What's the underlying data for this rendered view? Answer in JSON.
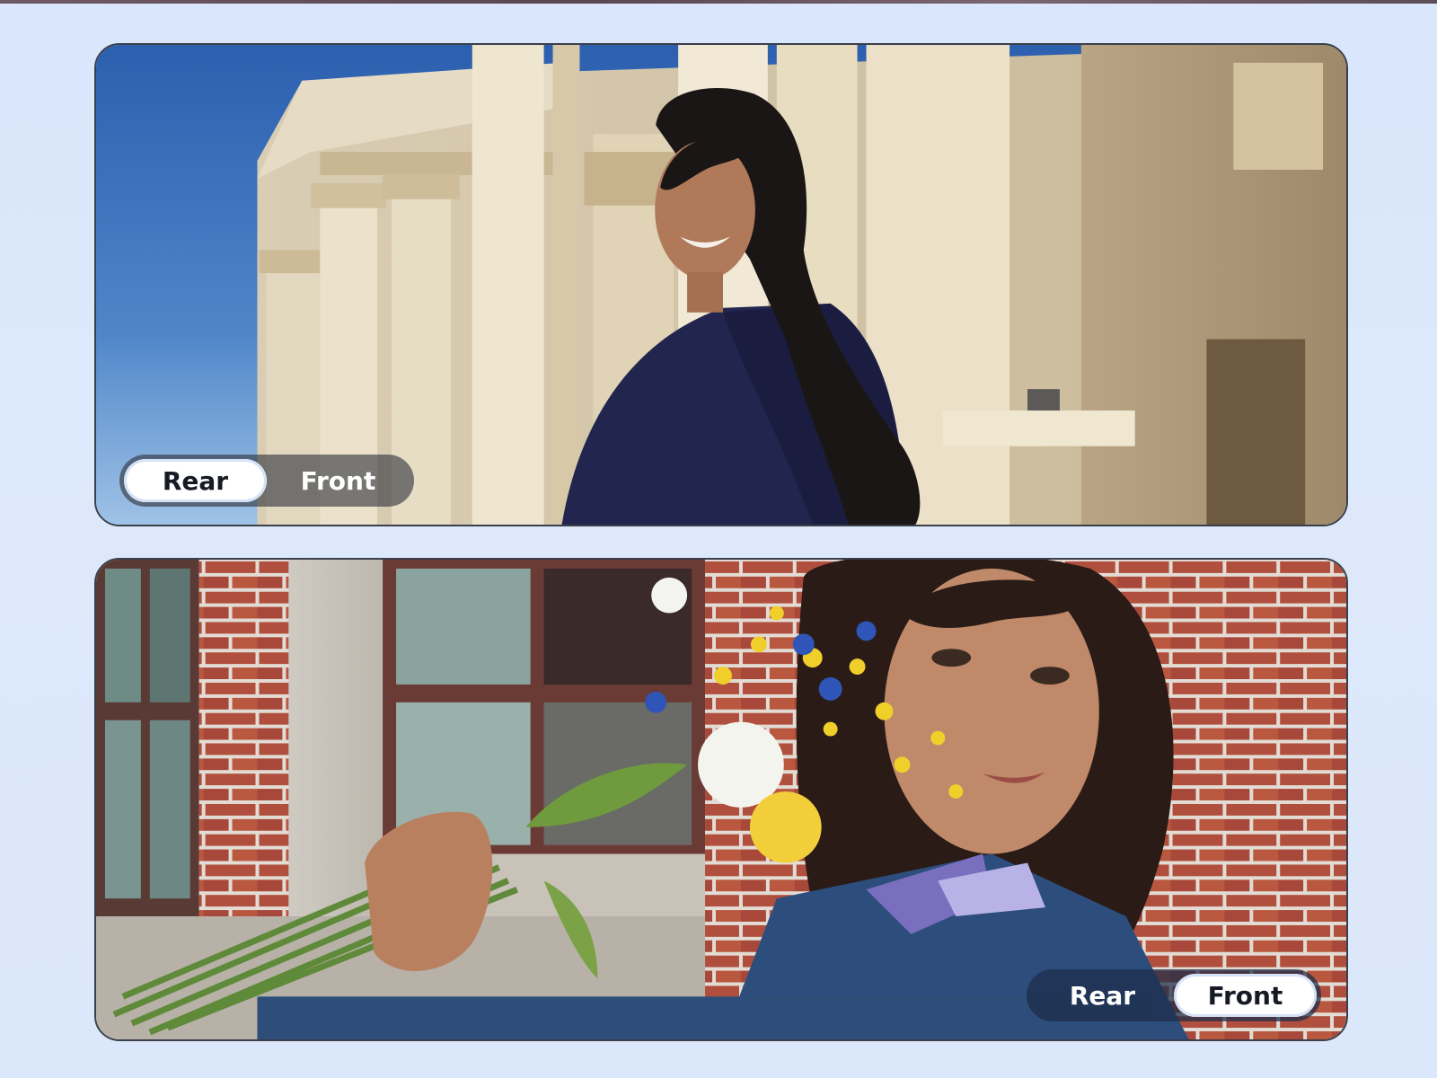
{
  "panels": [
    {
      "name": "rear-camera-sample",
      "toggle": {
        "options": [
          "Rear",
          "Front"
        ],
        "selected": "Rear"
      }
    },
    {
      "name": "front-camera-sample",
      "toggle": {
        "options": [
          "Rear",
          "Front"
        ],
        "selected": "Front"
      }
    }
  ],
  "colors": {
    "page_background": "#dbe7fa",
    "toggle_active": "#ffffff",
    "toggle_text": "#ffffff"
  }
}
